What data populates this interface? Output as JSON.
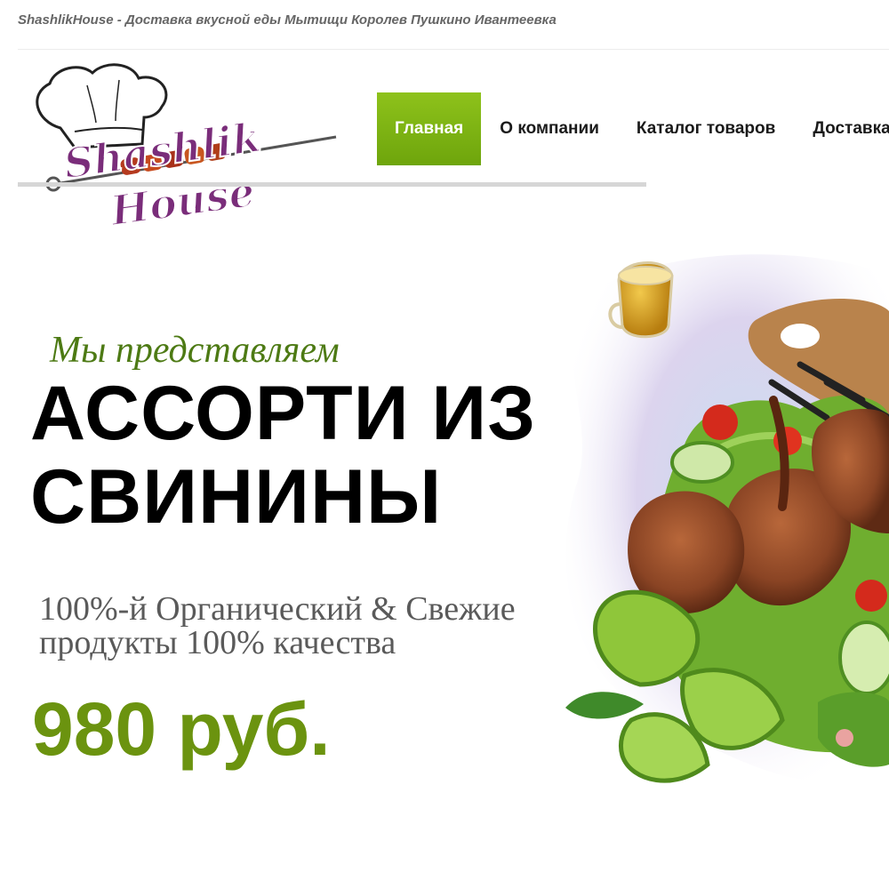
{
  "site": {
    "top_title": "ShashlikHouse - Доставка вкусной еды Мытищи Королев Пушкино Ивантеевка"
  },
  "logo": {
    "line1": "Shashlik",
    "line2": "House",
    "icon": "chef-hat-skewer-logo"
  },
  "nav": {
    "items": [
      {
        "label": "Главная",
        "active": true
      },
      {
        "label": "О компании",
        "active": false
      },
      {
        "label": "Каталог товаров",
        "active": false
      },
      {
        "label": "Доставка",
        "active": false
      }
    ]
  },
  "hero": {
    "subtitle": "Мы представляем",
    "headline": "АССОРТИ ИЗ СВИНИНЫ",
    "tagline": "100%-й Органический & Свежие продукты 100% качества",
    "price": "980 руб.",
    "image": "grilled-pork-assortment-with-salad-and-lime"
  },
  "colors": {
    "accent": "#7cb313",
    "price": "#6b930f",
    "subtitle": "#4d7a14",
    "logo_purple": "#7a2d7a"
  }
}
